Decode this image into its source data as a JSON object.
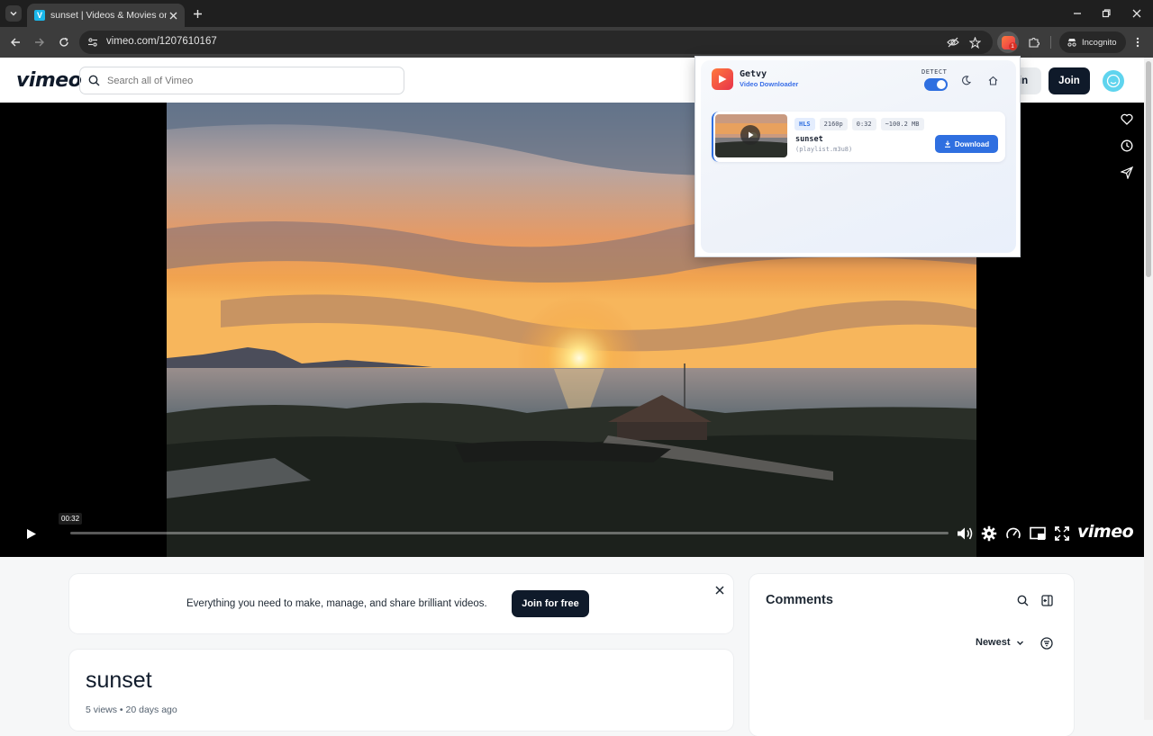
{
  "browser": {
    "tab_title": "sunset | Videos & Movies on Vimeo",
    "favicon_letter": "V",
    "url": "vimeo.com/1207610167",
    "incognito_label": "Incognito",
    "extension_badge": "1"
  },
  "vimeo": {
    "logo": "vimeo",
    "search_placeholder": "Search all of Vimeo",
    "login_label": "in",
    "join_label": "Join"
  },
  "player": {
    "current_time": "00:32",
    "progress": 0.0,
    "logo": "vimeo"
  },
  "banner": {
    "text": "Everything you need to make, manage, and share brilliant videos.",
    "button": "Join for free"
  },
  "video": {
    "title": "sunset",
    "meta": "5 views • 20 days ago"
  },
  "comments": {
    "title": "Comments",
    "sort": "Newest"
  },
  "extension": {
    "name": "Getvy",
    "subtitle": "Video Downloader",
    "detect_label": "DETECT",
    "detect_on": true,
    "item": {
      "tags": [
        "HLS",
        "2160p",
        "0:32",
        "~100.2 MB"
      ],
      "name": "sunset",
      "file": "(playlist.m3u8)",
      "download_label": "Download"
    }
  },
  "colors": {
    "accent": "#2f6fe0",
    "vimeo_dark": "#0f1a2a",
    "vimeo_cyan": "#1ab7ea"
  }
}
